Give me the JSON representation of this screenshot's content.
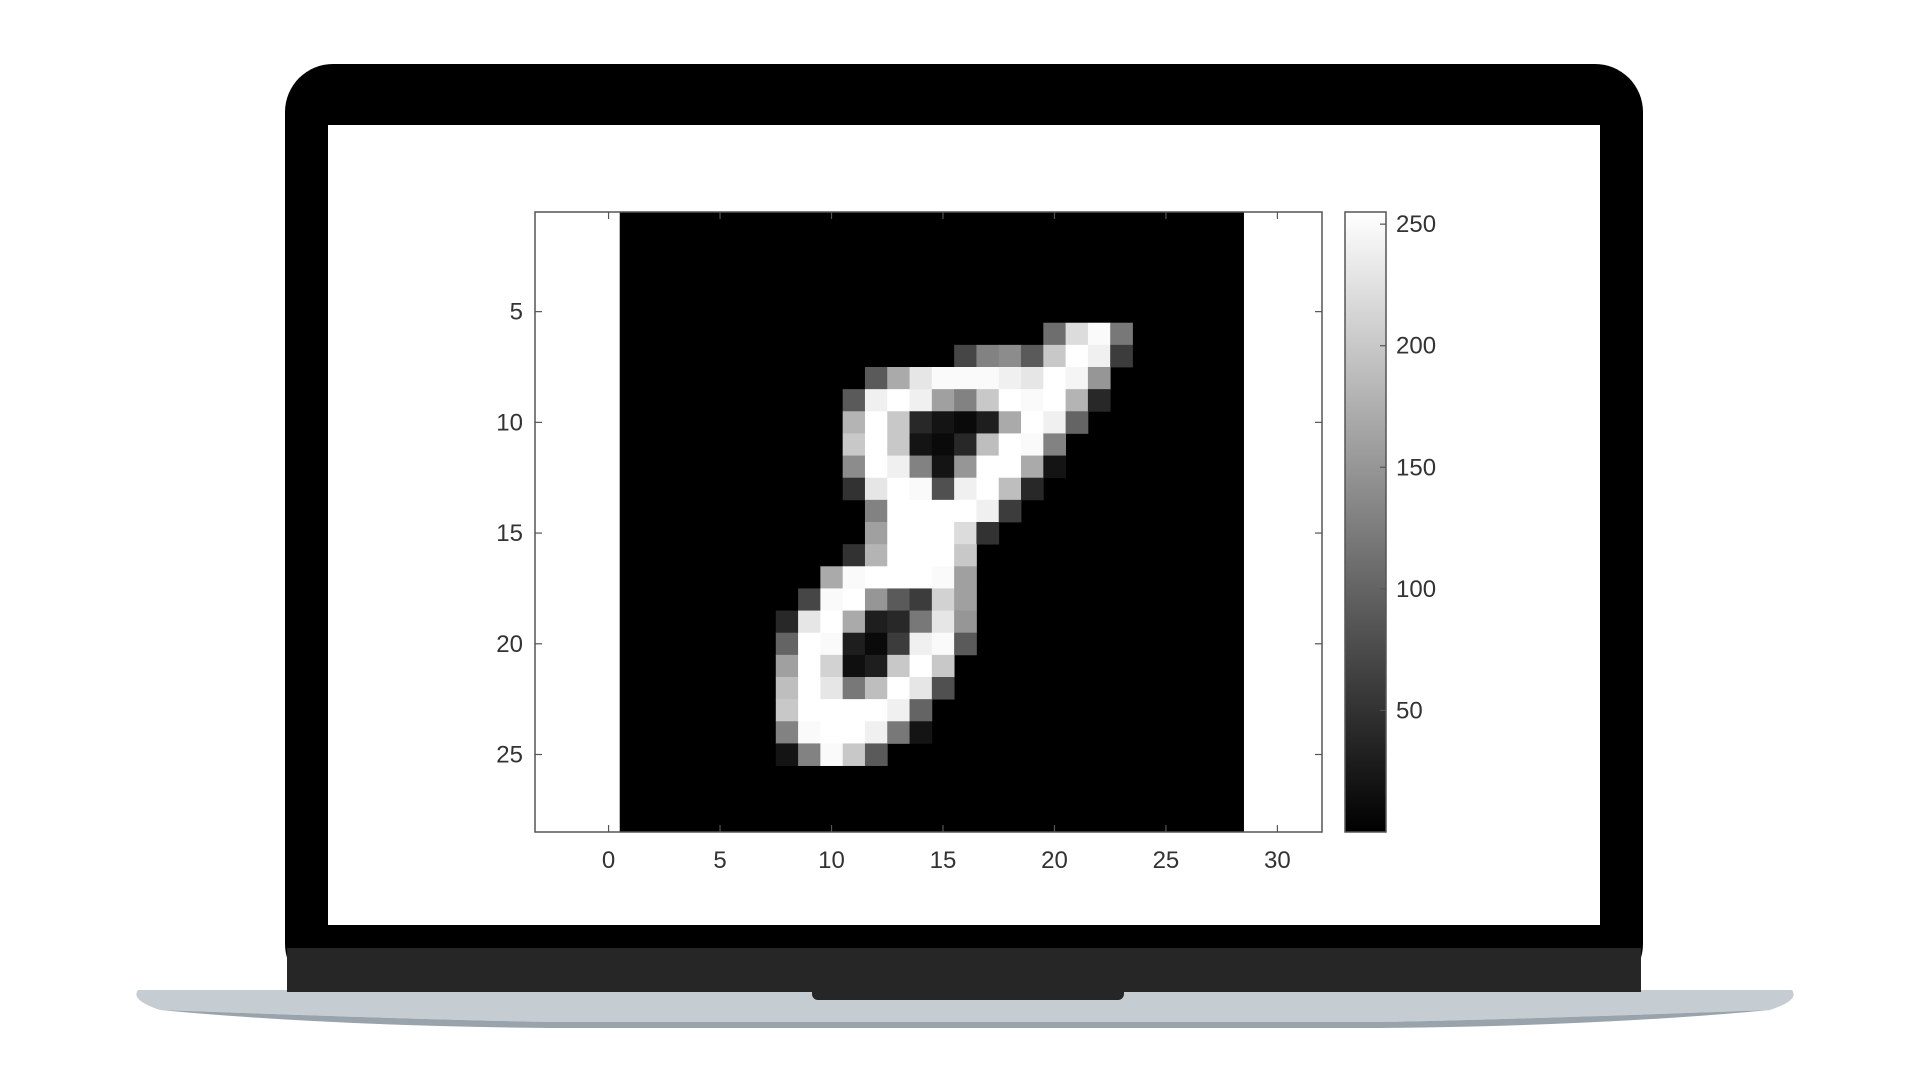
{
  "colors": {
    "bezel": "#000000",
    "hinge": "#262626",
    "base": "#c6cdd2",
    "base_shadow": "#98a3ab",
    "screen": "#ffffff",
    "axis": "#555555",
    "tick_text": "#333333"
  },
  "chart_data": {
    "type": "heatmap",
    "colormap": "gray",
    "image_size": [
      28,
      28
    ],
    "xlim": [
      -3.3,
      32
    ],
    "ylim": [
      28.5,
      0.5
    ],
    "x_ticks": [
      "0",
      "5",
      "10",
      "15",
      "20",
      "25",
      "30"
    ],
    "x_tick_values": [
      0,
      5,
      10,
      15,
      20,
      25,
      30
    ],
    "y_ticks": [
      "5",
      "10",
      "15",
      "20",
      "25"
    ],
    "y_tick_values": [
      5,
      10,
      15,
      20,
      25
    ],
    "colorbar": {
      "range": [
        0,
        255
      ],
      "ticks": [
        "250",
        "200",
        "150",
        "100",
        "50"
      ],
      "tick_values": [
        250,
        200,
        150,
        100,
        50
      ]
    },
    "pixels": [
      {
        "row": 6,
        "col": 20,
        "v": 110
      },
      {
        "row": 6,
        "col": 21,
        "v": 220
      },
      {
        "row": 6,
        "col": 22,
        "v": 250
      },
      {
        "row": 6,
        "col": 23,
        "v": 120
      },
      {
        "row": 7,
        "col": 16,
        "v": 70
      },
      {
        "row": 7,
        "col": 17,
        "v": 130
      },
      {
        "row": 7,
        "col": 18,
        "v": 140
      },
      {
        "row": 7,
        "col": 19,
        "v": 90
      },
      {
        "row": 7,
        "col": 20,
        "v": 200
      },
      {
        "row": 7,
        "col": 21,
        "v": 255
      },
      {
        "row": 7,
        "col": 22,
        "v": 240
      },
      {
        "row": 7,
        "col": 23,
        "v": 60
      },
      {
        "row": 8,
        "col": 12,
        "v": 90
      },
      {
        "row": 8,
        "col": 13,
        "v": 170
      },
      {
        "row": 8,
        "col": 14,
        "v": 230
      },
      {
        "row": 8,
        "col": 15,
        "v": 250
      },
      {
        "row": 8,
        "col": 16,
        "v": 250
      },
      {
        "row": 8,
        "col": 17,
        "v": 250
      },
      {
        "row": 8,
        "col": 18,
        "v": 240
      },
      {
        "row": 8,
        "col": 19,
        "v": 230
      },
      {
        "row": 8,
        "col": 20,
        "v": 255
      },
      {
        "row": 8,
        "col": 21,
        "v": 245
      },
      {
        "row": 8,
        "col": 22,
        "v": 150
      },
      {
        "row": 9,
        "col": 11,
        "v": 90
      },
      {
        "row": 9,
        "col": 12,
        "v": 240
      },
      {
        "row": 9,
        "col": 13,
        "v": 255
      },
      {
        "row": 9,
        "col": 14,
        "v": 240
      },
      {
        "row": 9,
        "col": 15,
        "v": 160
      },
      {
        "row": 9,
        "col": 16,
        "v": 130
      },
      {
        "row": 9,
        "col": 17,
        "v": 200
      },
      {
        "row": 9,
        "col": 18,
        "v": 255
      },
      {
        "row": 9,
        "col": 19,
        "v": 250
      },
      {
        "row": 9,
        "col": 20,
        "v": 255
      },
      {
        "row": 9,
        "col": 21,
        "v": 180
      },
      {
        "row": 9,
        "col": 22,
        "v": 40
      },
      {
        "row": 10,
        "col": 11,
        "v": 180
      },
      {
        "row": 10,
        "col": 12,
        "v": 255
      },
      {
        "row": 10,
        "col": 13,
        "v": 200
      },
      {
        "row": 10,
        "col": 14,
        "v": 40
      },
      {
        "row": 10,
        "col": 15,
        "v": 20
      },
      {
        "row": 10,
        "col": 16,
        "v": 10
      },
      {
        "row": 10,
        "col": 17,
        "v": 30
      },
      {
        "row": 10,
        "col": 18,
        "v": 170
      },
      {
        "row": 10,
        "col": 19,
        "v": 255
      },
      {
        "row": 10,
        "col": 20,
        "v": 240
      },
      {
        "row": 10,
        "col": 21,
        "v": 100
      },
      {
        "row": 11,
        "col": 11,
        "v": 200
      },
      {
        "row": 11,
        "col": 12,
        "v": 255
      },
      {
        "row": 11,
        "col": 13,
        "v": 200
      },
      {
        "row": 11,
        "col": 14,
        "v": 20
      },
      {
        "row": 11,
        "col": 15,
        "v": 10
      },
      {
        "row": 11,
        "col": 16,
        "v": 40
      },
      {
        "row": 11,
        "col": 17,
        "v": 190
      },
      {
        "row": 11,
        "col": 18,
        "v": 255
      },
      {
        "row": 11,
        "col": 19,
        "v": 250
      },
      {
        "row": 11,
        "col": 20,
        "v": 130
      },
      {
        "row": 12,
        "col": 11,
        "v": 140
      },
      {
        "row": 12,
        "col": 12,
        "v": 255
      },
      {
        "row": 12,
        "col": 13,
        "v": 240
      },
      {
        "row": 12,
        "col": 14,
        "v": 130
      },
      {
        "row": 12,
        "col": 15,
        "v": 20
      },
      {
        "row": 12,
        "col": 16,
        "v": 150
      },
      {
        "row": 12,
        "col": 17,
        "v": 255
      },
      {
        "row": 12,
        "col": 18,
        "v": 255
      },
      {
        "row": 12,
        "col": 19,
        "v": 170
      },
      {
        "row": 12,
        "col": 20,
        "v": 20
      },
      {
        "row": 13,
        "col": 11,
        "v": 50
      },
      {
        "row": 13,
        "col": 12,
        "v": 230
      },
      {
        "row": 13,
        "col": 13,
        "v": 255
      },
      {
        "row": 13,
        "col": 14,
        "v": 250
      },
      {
        "row": 13,
        "col": 15,
        "v": 80
      },
      {
        "row": 13,
        "col": 16,
        "v": 240
      },
      {
        "row": 13,
        "col": 17,
        "v": 255
      },
      {
        "row": 13,
        "col": 18,
        "v": 190
      },
      {
        "row": 13,
        "col": 19,
        "v": 40
      },
      {
        "row": 14,
        "col": 12,
        "v": 130
      },
      {
        "row": 14,
        "col": 13,
        "v": 255
      },
      {
        "row": 14,
        "col": 14,
        "v": 255
      },
      {
        "row": 14,
        "col": 15,
        "v": 255
      },
      {
        "row": 14,
        "col": 16,
        "v": 255
      },
      {
        "row": 14,
        "col": 17,
        "v": 240
      },
      {
        "row": 14,
        "col": 18,
        "v": 60
      },
      {
        "row": 15,
        "col": 12,
        "v": 160
      },
      {
        "row": 15,
        "col": 13,
        "v": 255
      },
      {
        "row": 15,
        "col": 14,
        "v": 255
      },
      {
        "row": 15,
        "col": 15,
        "v": 255
      },
      {
        "row": 15,
        "col": 16,
        "v": 220
      },
      {
        "row": 15,
        "col": 17,
        "v": 50
      },
      {
        "row": 16,
        "col": 11,
        "v": 50
      },
      {
        "row": 16,
        "col": 12,
        "v": 180
      },
      {
        "row": 16,
        "col": 13,
        "v": 255
      },
      {
        "row": 16,
        "col": 14,
        "v": 255
      },
      {
        "row": 16,
        "col": 15,
        "v": 255
      },
      {
        "row": 16,
        "col": 16,
        "v": 200
      },
      {
        "row": 17,
        "col": 10,
        "v": 170
      },
      {
        "row": 17,
        "col": 11,
        "v": 250
      },
      {
        "row": 17,
        "col": 12,
        "v": 255
      },
      {
        "row": 17,
        "col": 13,
        "v": 255
      },
      {
        "row": 17,
        "col": 14,
        "v": 255
      },
      {
        "row": 17,
        "col": 15,
        "v": 250
      },
      {
        "row": 17,
        "col": 16,
        "v": 160
      },
      {
        "row": 18,
        "col": 9,
        "v": 70
      },
      {
        "row": 18,
        "col": 10,
        "v": 250
      },
      {
        "row": 18,
        "col": 11,
        "v": 255
      },
      {
        "row": 18,
        "col": 12,
        "v": 150
      },
      {
        "row": 18,
        "col": 13,
        "v": 90
      },
      {
        "row": 18,
        "col": 14,
        "v": 60
      },
      {
        "row": 18,
        "col": 15,
        "v": 210
      },
      {
        "row": 18,
        "col": 16,
        "v": 160
      },
      {
        "row": 19,
        "col": 8,
        "v": 40
      },
      {
        "row": 19,
        "col": 9,
        "v": 230
      },
      {
        "row": 19,
        "col": 10,
        "v": 255
      },
      {
        "row": 19,
        "col": 11,
        "v": 170
      },
      {
        "row": 19,
        "col": 12,
        "v": 30
      },
      {
        "row": 19,
        "col": 13,
        "v": 40
      },
      {
        "row": 19,
        "col": 14,
        "v": 120
      },
      {
        "row": 19,
        "col": 15,
        "v": 230
      },
      {
        "row": 19,
        "col": 16,
        "v": 150
      },
      {
        "row": 20,
        "col": 8,
        "v": 100
      },
      {
        "row": 20,
        "col": 9,
        "v": 255
      },
      {
        "row": 20,
        "col": 10,
        "v": 250
      },
      {
        "row": 20,
        "col": 11,
        "v": 30
      },
      {
        "row": 20,
        "col": 12,
        "v": 10
      },
      {
        "row": 20,
        "col": 13,
        "v": 60
      },
      {
        "row": 20,
        "col": 14,
        "v": 240
      },
      {
        "row": 20,
        "col": 15,
        "v": 250
      },
      {
        "row": 20,
        "col": 16,
        "v": 90
      },
      {
        "row": 21,
        "col": 8,
        "v": 160
      },
      {
        "row": 21,
        "col": 9,
        "v": 255
      },
      {
        "row": 21,
        "col": 10,
        "v": 210
      },
      {
        "row": 21,
        "col": 11,
        "v": 15
      },
      {
        "row": 21,
        "col": 12,
        "v": 30
      },
      {
        "row": 21,
        "col": 13,
        "v": 200
      },
      {
        "row": 21,
        "col": 14,
        "v": 255
      },
      {
        "row": 21,
        "col": 15,
        "v": 200
      },
      {
        "row": 22,
        "col": 8,
        "v": 190
      },
      {
        "row": 22,
        "col": 9,
        "v": 255
      },
      {
        "row": 22,
        "col": 10,
        "v": 230
      },
      {
        "row": 22,
        "col": 11,
        "v": 120
      },
      {
        "row": 22,
        "col": 12,
        "v": 190
      },
      {
        "row": 22,
        "col": 13,
        "v": 255
      },
      {
        "row": 22,
        "col": 14,
        "v": 230
      },
      {
        "row": 22,
        "col": 15,
        "v": 80
      },
      {
        "row": 23,
        "col": 8,
        "v": 200
      },
      {
        "row": 23,
        "col": 9,
        "v": 255
      },
      {
        "row": 23,
        "col": 10,
        "v": 255
      },
      {
        "row": 23,
        "col": 11,
        "v": 255
      },
      {
        "row": 23,
        "col": 12,
        "v": 255
      },
      {
        "row": 23,
        "col": 13,
        "v": 240
      },
      {
        "row": 23,
        "col": 14,
        "v": 100
      },
      {
        "row": 24,
        "col": 8,
        "v": 130
      },
      {
        "row": 24,
        "col": 9,
        "v": 250
      },
      {
        "row": 24,
        "col": 10,
        "v": 255
      },
      {
        "row": 24,
        "col": 11,
        "v": 255
      },
      {
        "row": 24,
        "col": 12,
        "v": 240
      },
      {
        "row": 24,
        "col": 13,
        "v": 120
      },
      {
        "row": 24,
        "col": 14,
        "v": 20
      },
      {
        "row": 25,
        "col": 8,
        "v": 20
      },
      {
        "row": 25,
        "col": 9,
        "v": 130
      },
      {
        "row": 25,
        "col": 10,
        "v": 250
      },
      {
        "row": 25,
        "col": 11,
        "v": 200
      },
      {
        "row": 25,
        "col": 12,
        "v": 90
      }
    ]
  }
}
